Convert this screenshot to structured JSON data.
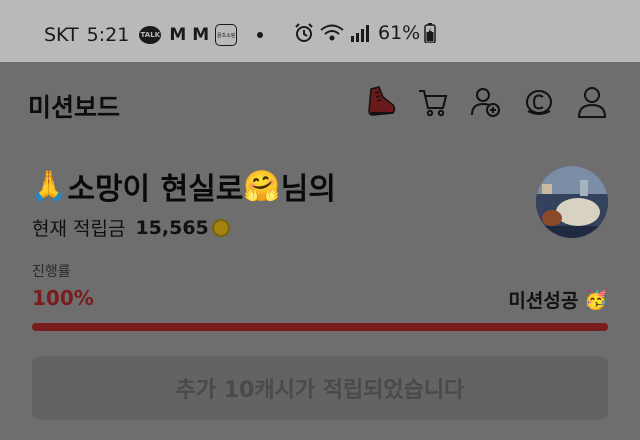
{
  "status_bar": {
    "carrier": "SKT",
    "time": "5:21",
    "talk_icon_text": "TALK",
    "app_icon_text": "꿀초소핑",
    "battery": "61%"
  },
  "app": {
    "title": "미션보드",
    "toolbar": [
      {
        "icon": "shoe-icon"
      },
      {
        "icon": "cart-icon"
      },
      {
        "icon": "add-friend-icon"
      },
      {
        "icon": "cash-coin-icon"
      },
      {
        "icon": "profile-icon"
      }
    ]
  },
  "user": {
    "prefix_emoji": "🙏",
    "name_part1": "소망이 현실로",
    "middle_emoji": "🤗",
    "suffix": "님의",
    "balance_label": "현재 적립금",
    "balance_value": "15,565"
  },
  "progress": {
    "label": "진행률",
    "percent_text": "100%",
    "value": 1.0,
    "status": "미션성공",
    "status_emoji": "🥳"
  },
  "reward": {
    "message": "추가 10캐시가 적립되었습니다"
  },
  "colors": {
    "accent": "#7a1b1e",
    "overlay": "#6e6e6e",
    "status_bar_bg": "#b9b9b9"
  }
}
